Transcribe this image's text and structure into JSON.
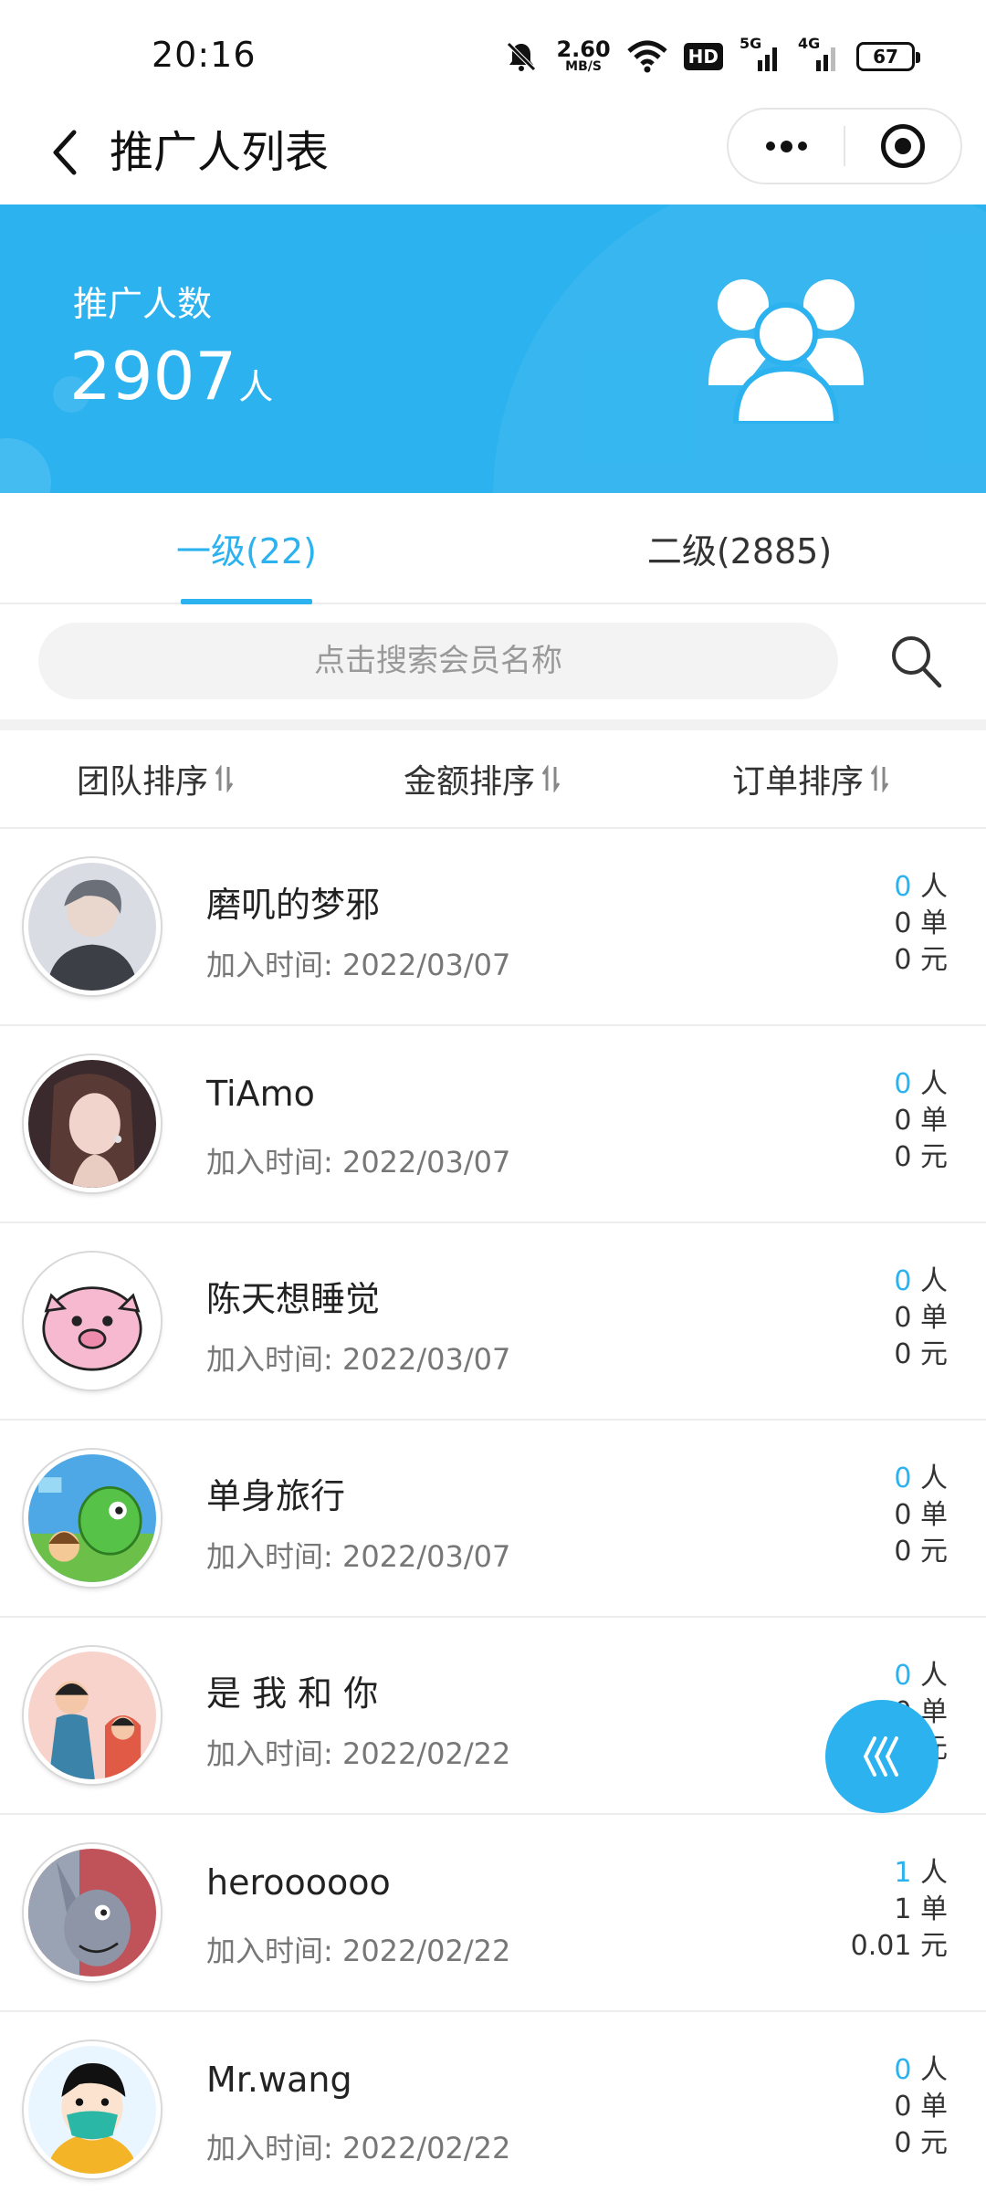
{
  "status_bar": {
    "time": "20:16",
    "net_speed_value": "2.60",
    "net_speed_unit": "MB/S",
    "hd_label": "HD",
    "signal_5g": "5G",
    "signal_4g": "4G",
    "battery": "67"
  },
  "nav": {
    "title": "推广人列表"
  },
  "banner": {
    "label": "推广人数",
    "count": "2907",
    "unit": "人"
  },
  "tabs": [
    {
      "label": "一级(22)",
      "active": true
    },
    {
      "label": "二级(2885)",
      "active": false
    }
  ],
  "search": {
    "placeholder": "点击搜索会员名称"
  },
  "sort": {
    "team": "团队排序",
    "amount": "金额排序",
    "order": "订单排序"
  },
  "members": [
    {
      "name": "磨叽的梦邪",
      "join_label": "加入时间: 2022/03/07",
      "people": "0",
      "people_unit": "人",
      "orders": "0 单",
      "amount": "0 元"
    },
    {
      "name": "TiAmo",
      "join_label": "加入时间: 2022/03/07",
      "people": "0",
      "people_unit": "人",
      "orders": "0 单",
      "amount": "0 元"
    },
    {
      "name": "陈天想睡觉",
      "join_label": "加入时间: 2022/03/07",
      "people": "0",
      "people_unit": "人",
      "orders": "0 单",
      "amount": "0 元"
    },
    {
      "name": "单身旅行",
      "join_label": "加入时间: 2022/03/07",
      "people": "0",
      "people_unit": "人",
      "orders": "0 单",
      "amount": "0 元"
    },
    {
      "name": "是 我 和 你",
      "join_label": "加入时间: 2022/02/22",
      "people": "0",
      "people_unit": "人",
      "orders": "0 单",
      "amount": "0 元"
    },
    {
      "name": "heroooooo",
      "join_label": "加入时间: 2022/02/22",
      "people": "1",
      "people_unit": "人",
      "orders": "1 单",
      "amount": "0.01 元"
    },
    {
      "name": "Mr.wang",
      "join_label": "加入时间: 2022/02/22",
      "people": "0",
      "people_unit": "人",
      "orders": "0 单",
      "amount": "0 元"
    }
  ],
  "colors": {
    "accent": "#2bb2ef",
    "text": "#333333",
    "muted": "#777777"
  }
}
